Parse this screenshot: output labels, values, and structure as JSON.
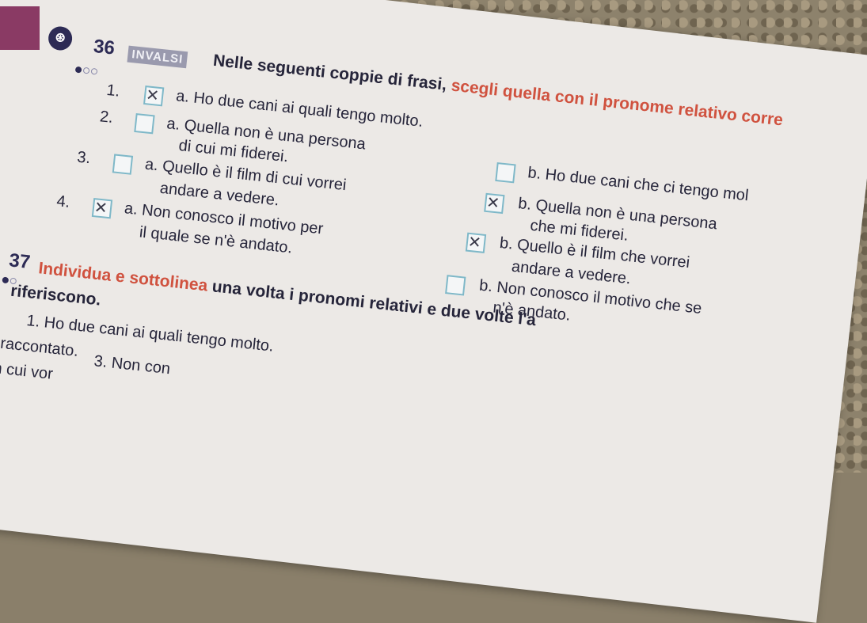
{
  "exercise36": {
    "number": "36",
    "tag": "INVALSI",
    "instruction_a": "Nelle seguenti coppie di frasi, ",
    "instruction_hl": "scegli quella con il pronome relativo corre",
    "items": [
      {
        "num": "1.",
        "a_text": "a. Ho due cani ai quali tengo molto.",
        "a_checked": true,
        "b_text": "b. Ho due cani che ci tengo mol",
        "b_checked": false
      },
      {
        "num": "2.",
        "a_text": "a. Quella non è una persona",
        "a_text2": "di cui mi fiderei.",
        "a_checked": false,
        "b_text": "b. Quella non è una persona",
        "b_text2": "che mi fiderei.",
        "b_checked": true
      },
      {
        "num": "3.",
        "a_text": "a. Quello è il film di cui vorrei",
        "a_text2": "andare a vedere.",
        "a_checked": false,
        "b_text": "b. Quello è il film che vorrei",
        "b_text2": "andare a vedere.",
        "b_checked": true
      },
      {
        "num": "4.",
        "a_text": "a. Non conosco il motivo per",
        "a_text2": "il quale se n'è andato.",
        "a_checked": true,
        "b_text": "b. Non conosco il motivo che se",
        "b_text2": "n'è andato.",
        "b_checked": false
      }
    ]
  },
  "exercise37": {
    "number": "37",
    "instruction_hl": "Individua e sottolinea",
    "instruction_rest": " una volta i pronomi relativi e due volte l'a",
    "instruction_line2": "riferiscono.",
    "line1": "1. Ho due cani ai quali tengo molto.",
    "line2a": "raccontato.",
    "line2b": "3. Non con",
    "line3": "in cui vor"
  },
  "colors": {
    "accent": "#d0523f",
    "navy": "#2d2b55",
    "checkbox": "#7fb8c8"
  }
}
